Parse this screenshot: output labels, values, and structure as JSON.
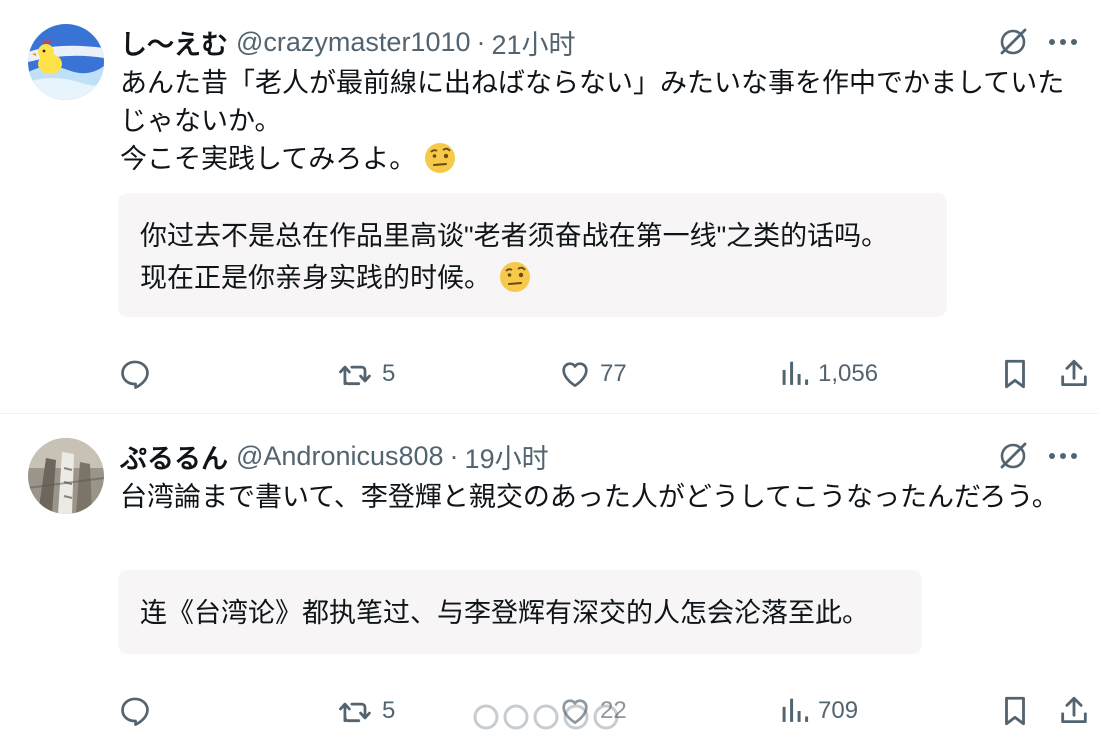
{
  "tweets": [
    {
      "display_name": "し〜えむ",
      "handle": "@crazymaster1010",
      "separator": "·",
      "time": "21小时",
      "text": "あんた昔「老人が最前線に出ねばならない」みたいな事を作中でかましていたじゃないか。\n今こそ実践してみろよ。",
      "text_emoji": "face-with-raised-eyebrow",
      "translation": "你过去不是总在作品里高谈\"老者须奋战在第一线\"之类的话吗。\n现在正是你亲身实践的时候。",
      "translation_emoji": "face-with-raised-eyebrow",
      "avatar_icon": "cartoon-chick-avatar",
      "replies": "",
      "retweets": "5",
      "likes": "77",
      "views": "1,056"
    },
    {
      "display_name": "ぷるるん",
      "handle": "@Andronicus808",
      "separator": "·",
      "time": "19小时",
      "text": "台湾論まで書いて、李登輝と親交のあった人がどうしてこうなったんだろう。",
      "translation": "连《台湾论》都执笔过、与李登辉有深交的人怎会沦落至此。",
      "avatar_icon": "photo-avatar",
      "replies": "",
      "retweets": "5",
      "likes": "22",
      "views": "709"
    }
  ],
  "icons": {
    "grok": "grok-icon",
    "more": "more-options-icon",
    "reply": "reply-icon",
    "retweet": "retweet-icon",
    "like": "heart-icon",
    "views": "views-icon",
    "bookmark": "bookmark-icon",
    "share": "share-icon"
  },
  "colors": {
    "text": "#0f1419",
    "secondary": "#536471",
    "translation_bg": "#f7f5f5",
    "divider": "#eff3f4"
  }
}
